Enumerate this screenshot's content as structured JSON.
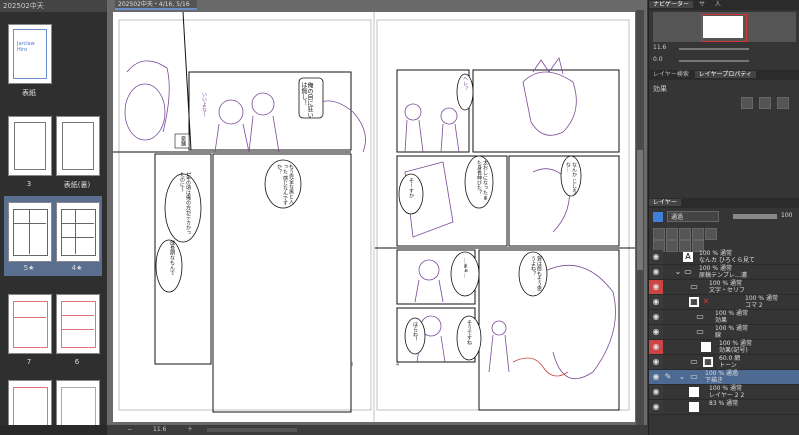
{
  "left_panel": {
    "tab_label": "202502中天",
    "pages": [
      {
        "label": "表紙"
      },
      {
        "label_left": "3",
        "label_right": "表紙(裏)"
      },
      {
        "label_left": "5★",
        "label_right": "4★"
      },
      {
        "label_left": "7",
        "label_right": "6"
      }
    ],
    "cover_text": "Jarclaw\nHiro"
  },
  "canvas": {
    "doc_tab": "202502中天・4/16, 5/16",
    "zoom": "11.6",
    "page_marker_left": "4",
    "page_marker_right": "4",
    "bubbles": {
      "b1": "俺の目に狂いは無し！",
      "b2": "案舗",
      "b3": "もう完全な黒と入った 感じなんですか？",
      "b4": "1年の頃は俺の方がデカかったのに〜",
      "b5": "成長期なもんで",
      "b6": "いいよな〜",
      "b7": "そーすか",
      "b8": "太おしになったまた身長伸びた？",
      "b9": "…まぁ…",
      "b10": "賀は郎もそう思うよね？",
      "b11": "ほらね！",
      "b12": "そうですね",
      "b13": "なんか じしろな…",
      "b14": "ヘレ？"
    }
  },
  "right_panel": {
    "tabs": [
      "ナビゲーター",
      "サ",
      "人"
    ],
    "zoom_value": "11.6",
    "rotation_value": "0.0",
    "sub_tabs": [
      "レイヤー検索",
      "レイヤープロパティ"
    ],
    "effect_label": "効果",
    "layer_tab": "レイヤー",
    "blend_mode": "通過",
    "opacity": "100",
    "layers": [
      {
        "pct": "100 % 通常",
        "name": "なんカ ひろくら見て",
        "red": false,
        "depth": 0,
        "icon": "A"
      },
      {
        "pct": "100 % 通常",
        "name": "原稿テンプレ…濃",
        "red": false,
        "depth": 0,
        "icon": "▭"
      },
      {
        "pct": "100 % 通常",
        "name": "文字・セリフ",
        "red": true,
        "depth": 1,
        "icon": "▭"
      },
      {
        "pct": "100 % 通常",
        "name": "コマ 2",
        "red": false,
        "depth": 1,
        "icon": "▦"
      },
      {
        "pct": "100 % 通常",
        "name": "効果",
        "red": false,
        "depth": 2,
        "icon": "▭"
      },
      {
        "pct": "100 % 通常",
        "name": "線",
        "red": false,
        "depth": 2,
        "icon": "▭"
      },
      {
        "pct": "100 % 通常",
        "name": "効果(記号)",
        "red": true,
        "depth": 2,
        "icon": "▭"
      },
      {
        "pct": "60.0 網",
        "name": "トーン",
        "red": false,
        "depth": 1,
        "icon": "▦"
      },
      {
        "pct": "100 % 通過",
        "name": "下描き",
        "red": false,
        "depth": 0,
        "icon": "▭",
        "selected": true
      },
      {
        "pct": "100 % 通常",
        "name": "レイヤー 2 2",
        "red": false,
        "depth": 1,
        "icon": "▦"
      },
      {
        "pct": "83 % 通常",
        "name": "",
        "red": false,
        "depth": 1,
        "icon": "▦"
      }
    ]
  },
  "colors": {
    "accent": "#4d6a93",
    "sketch": "#7b4a9a",
    "red_marker": "#c44"
  }
}
